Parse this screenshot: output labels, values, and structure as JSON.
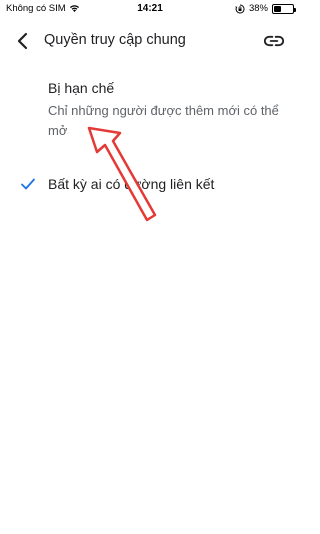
{
  "status_bar": {
    "carrier": "Không có SIM",
    "time": "14:21",
    "battery_percent_label": "38%",
    "battery_level": 0.38,
    "icons": [
      "wifi-icon",
      "lock-rotation-icon",
      "battery-icon"
    ]
  },
  "app_bar": {
    "title": "Quyền truy cập chung",
    "back_icon": "chevron-left-icon",
    "link_icon": "link-icon"
  },
  "options": {
    "restricted": {
      "title": "Bị hạn chế",
      "description": "Chỉ những người được thêm mới có thể mở",
      "selected": false
    },
    "anyone_with_link": {
      "title": "Bất kỳ ai có đường liên kết",
      "selected": true,
      "check_icon": "check-icon"
    }
  },
  "colors": {
    "accent": "#1a73e8",
    "annotation_arrow": "#e53935",
    "text_primary": "#202124",
    "text_secondary": "#5f6368"
  }
}
